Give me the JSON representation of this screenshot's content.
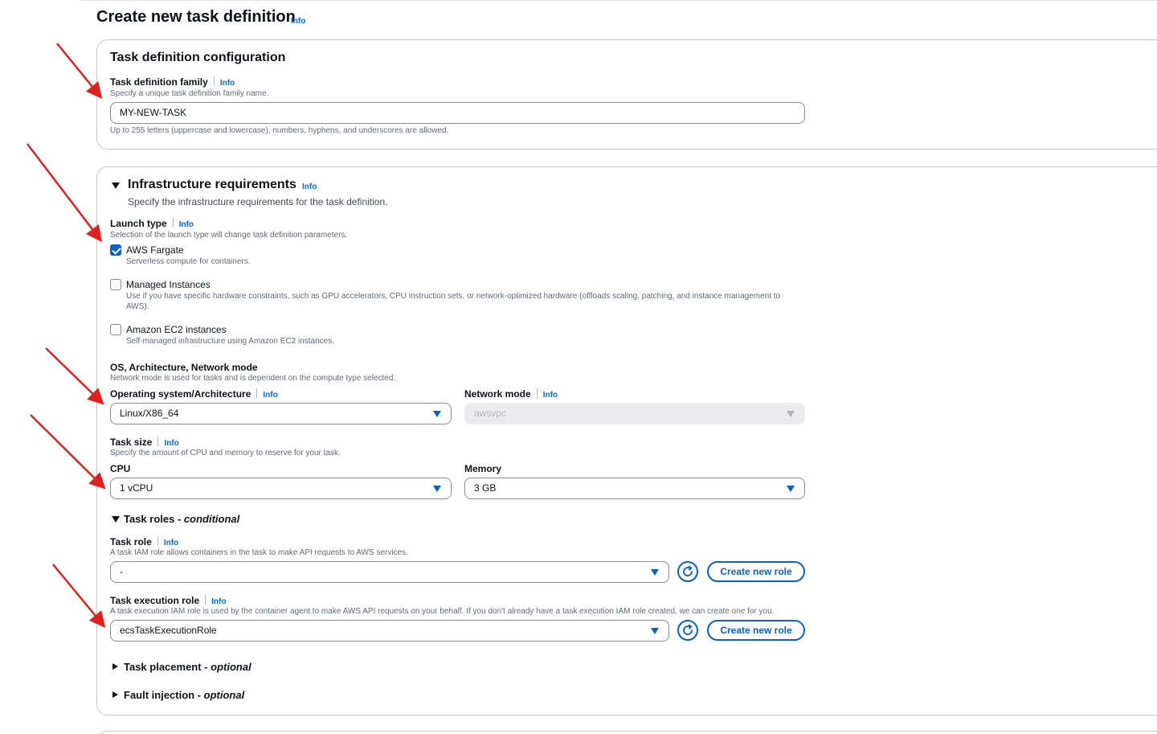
{
  "page": {
    "title": "Create new task definition",
    "info": "Info"
  },
  "config": {
    "heading": "Task definition configuration",
    "family_label": "Task definition family",
    "family_info": "Info",
    "family_desc": "Specify a unique task definition family name.",
    "family_value": "MY-NEW-TASK",
    "family_hint": "Up to 255 letters (uppercase and lowercase), numbers, hyphens, and underscores are allowed."
  },
  "infra": {
    "heading": "Infrastructure requirements",
    "info": "Info",
    "desc": "Specify the infrastructure requirements for the task definition.",
    "launch_label": "Launch type",
    "launch_info": "Info",
    "launch_desc": "Selection of the launch type will change task definition parameters.",
    "options": [
      {
        "label": "AWS Fargate",
        "desc": "Serverless compute for containers.",
        "checked": true
      },
      {
        "label": "Managed Instances",
        "desc": "Use if you have specific hardware constraints, such as GPU accelerators, CPU instruction sets, or network-optimized hardware (offloads scaling, patching, and instance management to AWS).",
        "checked": false
      },
      {
        "label": "Amazon EC2 instances",
        "desc": "Self-managed infrastructure using Amazon EC2 instances.",
        "checked": false
      }
    ],
    "os_group_label": "OS, Architecture, Network mode",
    "os_group_desc": "Network mode is used for tasks and is dependent on the compute type selected.",
    "os_label": "Operating system/Architecture",
    "os_info": "Info",
    "os_value": "Linux/X86_64",
    "netmode_label": "Network mode",
    "netmode_info": "Info",
    "netmode_value": "awsvpc",
    "tasksize_label": "Task size",
    "tasksize_info": "Info",
    "tasksize_desc": "Specify the amount of CPU and memory to reserve for your task.",
    "cpu_label": "CPU",
    "cpu_value": "1 vCPU",
    "memory_label": "Memory",
    "memory_value": "3 GB"
  },
  "roles": {
    "toggle_label": "Task roles - ",
    "toggle_suffix": "conditional",
    "task_role_label": "Task role",
    "task_role_info": "Info",
    "task_role_desc": "A task IAM role allows containers in the task to make API requests to AWS services.",
    "task_role_value": "-",
    "exec_role_label": "Task execution role",
    "exec_role_info": "Info",
    "exec_role_desc": "A task execution IAM role is used by the container agent to make AWS API requests on your behalf. If you don't already have a task execution IAM role created, we can create one for you.",
    "exec_role_value": "ecsTaskExecutionRole",
    "create_role_label": "Create new role"
  },
  "placement": {
    "label": "Task placement - ",
    "suffix": "optional"
  },
  "fault": {
    "label": "Fault injection - ",
    "suffix": "optional"
  },
  "colors": {
    "accent": "#0f5fc8",
    "link": "#006ce0",
    "annotation_arrow": "#e02020"
  }
}
